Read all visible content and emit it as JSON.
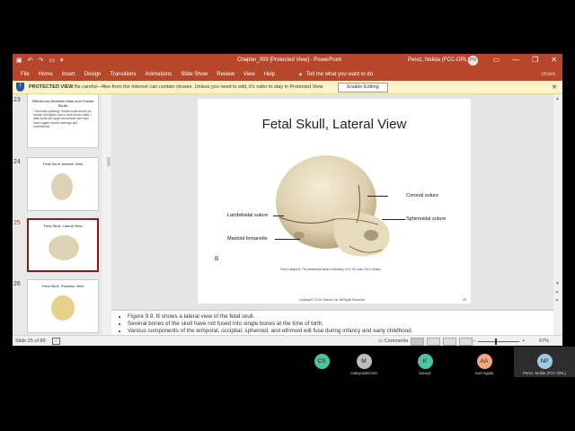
{
  "window": {
    "title": "Chapter_009 [Protected View] - PowerPoint",
    "user_name": "Perez, Nelida (FCC-ORL)",
    "user_initials": "PN",
    "minimize": "—",
    "restore": "❐",
    "close": "✕"
  },
  "ribbon": {
    "tabs": [
      "File",
      "Home",
      "Insert",
      "Design",
      "Transitions",
      "Animations",
      "Slide Show",
      "Review",
      "View",
      "Help"
    ],
    "tell_me": "Tell me what you want to do",
    "share": "Share"
  },
  "protected_view": {
    "label": "PROTECTED VIEW",
    "message": "Be careful—files from the Internet can contain viruses. Unless you need to edit, it's safer to stay in Protected View.",
    "button": "Enable Editing",
    "close": "✕"
  },
  "thumbnails": [
    {
      "number": "23",
      "title": "Differences Between Male and Female Skulls",
      "body": "• Generally speaking, female skulls tend to be smaller and lighter and to have thinner walls. • Male skulls are larger and heavier and have more rugged muscle markings and prominences."
    },
    {
      "number": "24",
      "title": "Fetal Skull, Anterior View",
      "body": ""
    },
    {
      "number": "25",
      "title": "Fetal Skull, Lateral View",
      "body": ""
    },
    {
      "number": "26",
      "title": "Fetal Skull, Posterior View",
      "body": ""
    }
  ],
  "slide": {
    "title": "Fetal Skull, Lateral View",
    "labels": {
      "coronal": "Coronal suture",
      "lambdoidal": "Lambdoidal suture",
      "sphenoidal": "Sphenoidal suture",
      "mastoid": "Mastoid fontanelle"
    },
    "panel_letter": "B",
    "credit": "From Lalegoli B. The anatomical basis of dentistry, ed 3, St Louis, 2010, Mosby.",
    "copyright": "Copyright © 2016, Elsevier Inc. All Rights Reserved.",
    "page_number": "25"
  },
  "notes": [
    "Figure 9.9, B shows a lateral view of the fetal skull.",
    "Several bones of the skull have not fused into single bones at the time of birth.",
    "Various components of the temporal, occipital, sphenoid, and ethmoid will fuse during infancy and early childhood."
  ],
  "status": {
    "slide_count": "Slide 25 of 89",
    "comments": "Comments",
    "zoom_percent": "67%"
  },
  "participants": [
    {
      "initials": "CS",
      "name": "",
      "color": "#4fc3a1"
    },
    {
      "initials": "M",
      "name": "maloyciatmoreh",
      "color": "#bdbdbd"
    },
    {
      "initials": "K",
      "name": "kvexyd",
      "color": "#4fc3a1"
    },
    {
      "initials": "AA",
      "name": "Axel Aguila",
      "color": "#f4a582"
    },
    {
      "initials": "NP",
      "name": "Perez, Nelida (FCC-ORL)",
      "color": "#9ecae1"
    }
  ]
}
